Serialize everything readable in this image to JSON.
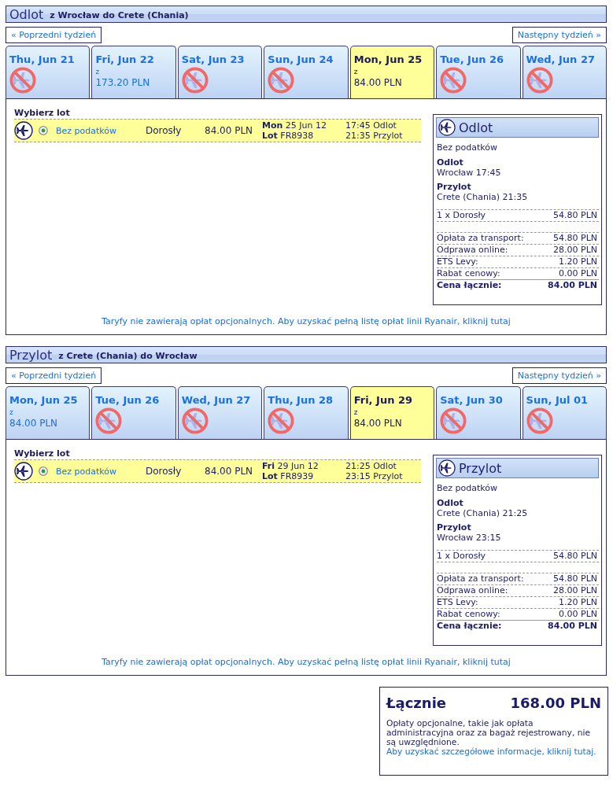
{
  "sections": [
    {
      "title": "Odlot",
      "route": "z Wrocław do Crete (Chania)",
      "prev_week": "« Poprzedni tydzień",
      "next_week": "Następny tydzień »",
      "days": [
        {
          "label": "Thu, Jun 21",
          "available": false,
          "selected": false
        },
        {
          "label": "Fri, Jun 22",
          "available": true,
          "from": "z",
          "price": "173.20 PLN",
          "selected": false
        },
        {
          "label": "Sat, Jun 23",
          "available": false,
          "selected": false
        },
        {
          "label": "Sun, Jun 24",
          "available": false,
          "selected": false
        },
        {
          "label": "Mon, Jun 25",
          "available": true,
          "from": "z",
          "price": "84.00 PLN",
          "selected": true
        },
        {
          "label": "Tue, Jun 26",
          "available": false,
          "selected": false
        },
        {
          "label": "Wed, Jun 27",
          "available": false,
          "selected": false
        }
      ],
      "choose_title": "Wybierz lot",
      "flights": [
        {
          "selected": true,
          "fare": "Bez podatków",
          "passenger": "Dorosły",
          "price": "84.00 PLN",
          "date": "**Mon** 25 Jun 12",
          "flight": "**Lot** FR8938",
          "departure": "17:45 Odlot",
          "arrival": "21:35 Przylot"
        }
      ],
      "summary": {
        "title": "Odlot",
        "fare": "Bez podatków",
        "departure_label": "Odlot",
        "departure": "Wrocław 17:45",
        "arrival_label": "Przylot",
        "arrival": "Crete (Chania) 21:35",
        "passengers": [
          {
            "label": "1 x Dorosły",
            "amount": "54.80 PLN"
          }
        ],
        "charges": [
          {
            "label": "Opłata za transport:",
            "amount": "54.80 PLN"
          },
          {
            "label": "Odprawa online:",
            "amount": "28.00 PLN"
          },
          {
            "label": "ETS Levy:",
            "amount": "1.20 PLN"
          },
          {
            "label": "Rabat cenowy:",
            "amount": "0.00 PLN"
          }
        ],
        "total": {
          "label": "Cena łącznie:",
          "amount": "84.00 PLN"
        }
      },
      "note": "Taryfy nie zawierają opłat opcjonalnych. Aby uzyskać pełną listę opłat linii Ryanair, kliknij tutaj"
    },
    {
      "title": "Przylot",
      "route": "z Crete (Chania) do Wrocław",
      "prev_week": "« Poprzedni tydzień",
      "next_week": "Następny tydzień »",
      "days": [
        {
          "label": "Mon, Jun 25",
          "available": true,
          "from": "z",
          "price": "84.00 PLN",
          "selected": false
        },
        {
          "label": "Tue, Jun 26",
          "available": false,
          "selected": false
        },
        {
          "label": "Wed, Jun 27",
          "available": false,
          "selected": false
        },
        {
          "label": "Thu, Jun 28",
          "available": false,
          "selected": false
        },
        {
          "label": "Fri, Jun 29",
          "available": true,
          "from": "z",
          "price": "84.00 PLN",
          "selected": true
        },
        {
          "label": "Sat, Jun 30",
          "available": false,
          "selected": false
        },
        {
          "label": "Sun, Jul 01",
          "available": false,
          "selected": false
        }
      ],
      "choose_title": "Wybierz lot",
      "flights": [
        {
          "selected": true,
          "fare": "Bez podatków",
          "passenger": "Dorosły",
          "price": "84.00 PLN",
          "date": "**Fri** 29 Jun 12",
          "flight": "**Lot** FR8939",
          "departure": "21:25 Odlot",
          "arrival": "23:15 Przylot"
        }
      ],
      "summary": {
        "title": "Przylot",
        "fare": "Bez podatków",
        "departure_label": "Odlot",
        "departure": "Crete (Chania) 21:25",
        "arrival_label": "Przylot",
        "arrival": "Wrocław 23:15",
        "passengers": [
          {
            "label": "1 x Dorosły",
            "amount": "54.80 PLN"
          }
        ],
        "charges": [
          {
            "label": "Opłata za transport:",
            "amount": "54.80 PLN"
          },
          {
            "label": "Odprawa online:",
            "amount": "28.00 PLN"
          },
          {
            "label": "ETS Levy:",
            "amount": "1.20 PLN"
          },
          {
            "label": "Rabat cenowy:",
            "amount": "0.00 PLN"
          }
        ],
        "total": {
          "label": "Cena łącznie:",
          "amount": "84.00 PLN"
        }
      },
      "note": "Taryfy nie zawierają opłat opcjonalnych. Aby uzyskać pełną listę opłat linii Ryanair, kliknij tutaj"
    }
  ],
  "total": {
    "label": "Łącznie",
    "amount": "168.00 PLN",
    "note": "Opłaty opcjonalne, takie jak opłata administracyjna oraz za bagaż rejestrowany, nie są uwzględnione.",
    "link": "Aby uzyskać szczegółowe informacje, kliknij tutaj."
  }
}
